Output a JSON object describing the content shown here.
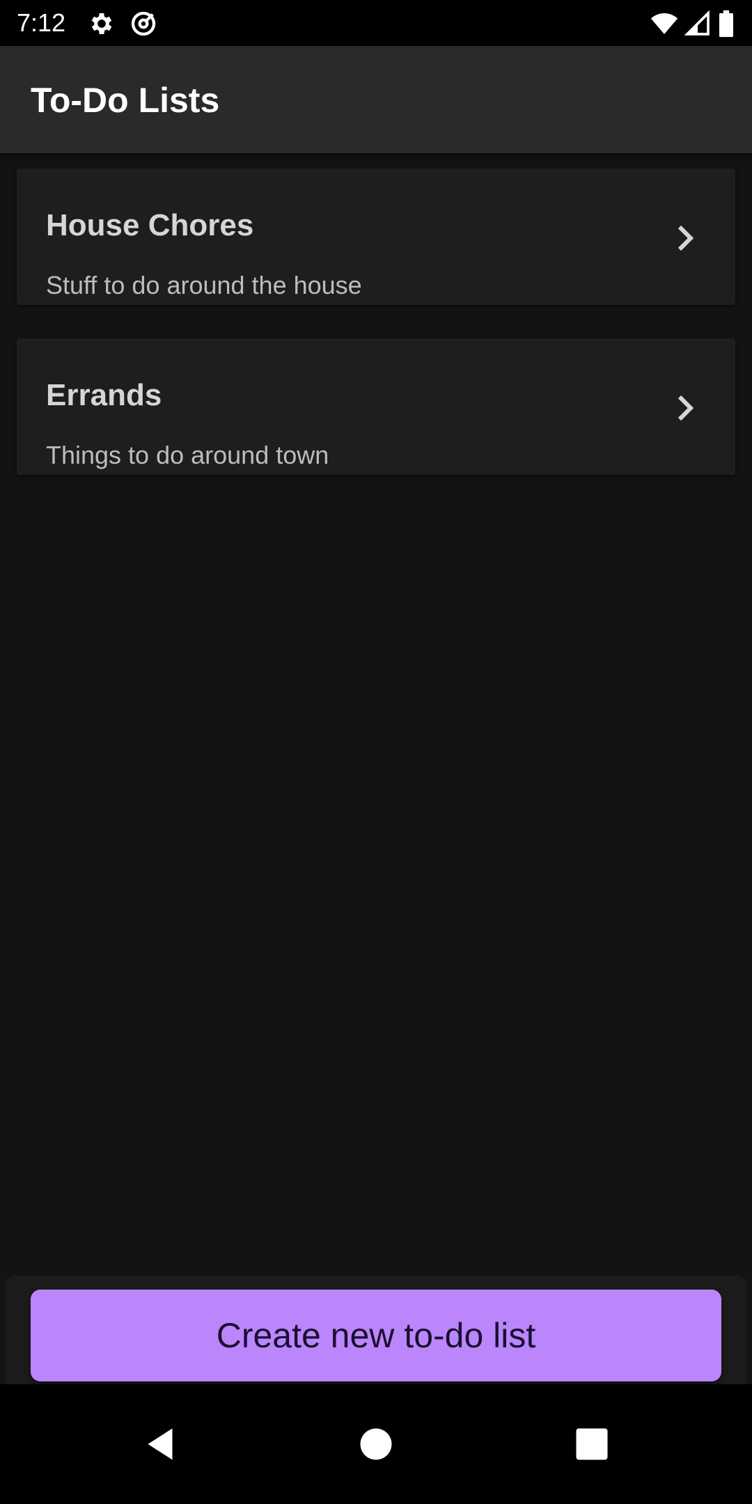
{
  "status_bar": {
    "time": "7:12",
    "icons": [
      "settings-icon",
      "at-sign-icon",
      "wifi-icon",
      "cell-signal-icon",
      "battery-icon"
    ]
  },
  "app_bar": {
    "title": "To-Do Lists"
  },
  "lists": [
    {
      "title": "House Chores",
      "subtitle": "Stuff to do around the house"
    },
    {
      "title": "Errands",
      "subtitle": "Things to do around town"
    }
  ],
  "actions": {
    "create_label": "Create new to-do list"
  },
  "nav_bar": {
    "icons": [
      "back-icon",
      "home-icon",
      "recents-icon"
    ]
  },
  "colors": {
    "background": "#131313",
    "app_bar": "#2a2a2a",
    "card": "#1e1e1e",
    "accent": "#bb86fc"
  }
}
